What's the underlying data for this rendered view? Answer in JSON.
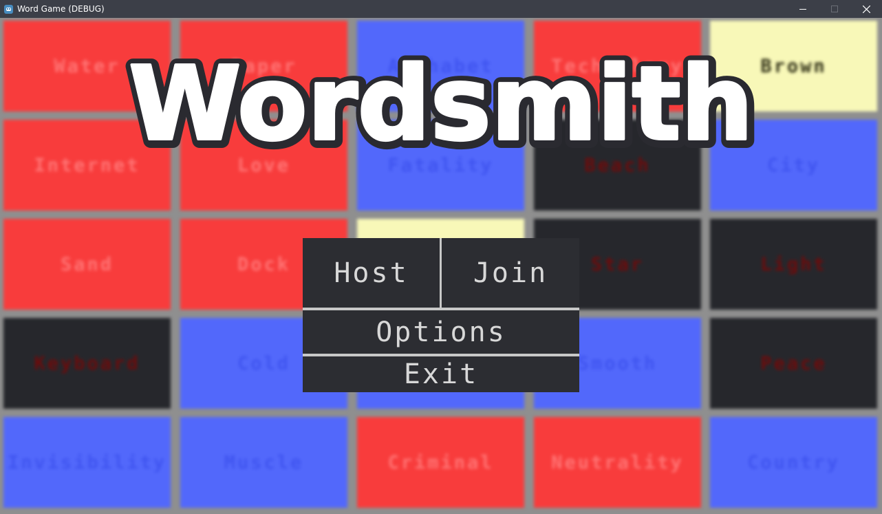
{
  "window": {
    "title": "Word Game (DEBUG)",
    "controls": [
      "minimize-icon",
      "maximize-icon",
      "close-icon"
    ]
  },
  "logo": {
    "text": "Wordsmith"
  },
  "menu": {
    "host": "Host",
    "join": "Join",
    "options": "Options",
    "exit": "Exit"
  },
  "board": {
    "cards": [
      {
        "word": "Water",
        "color": "red"
      },
      {
        "word": "Paper",
        "color": "red"
      },
      {
        "word": "Alphabet",
        "color": "blue"
      },
      {
        "word": "Technology",
        "color": "red"
      },
      {
        "word": "Brown",
        "color": "yellow"
      },
      {
        "word": "Internet",
        "color": "red"
      },
      {
        "word": "Love",
        "color": "red"
      },
      {
        "word": "Fatality",
        "color": "blue"
      },
      {
        "word": "Beach",
        "color": "black"
      },
      {
        "word": "City",
        "color": "blue"
      },
      {
        "word": "Sand",
        "color": "red"
      },
      {
        "word": "Dock",
        "color": "red"
      },
      {
        "word": "",
        "color": "yellow"
      },
      {
        "word": "Star",
        "color": "black"
      },
      {
        "word": "Light",
        "color": "black"
      },
      {
        "word": "Keyboard",
        "color": "black"
      },
      {
        "word": "Cold",
        "color": "blue"
      },
      {
        "word": "",
        "color": "blue"
      },
      {
        "word": "Smooth",
        "color": "blue"
      },
      {
        "word": "Peace",
        "color": "black"
      },
      {
        "word": "Invisibility",
        "color": "blue"
      },
      {
        "word": "Muscle",
        "color": "blue"
      },
      {
        "word": "Criminal",
        "color": "red"
      },
      {
        "word": "Neutrality",
        "color": "red"
      },
      {
        "word": "Country",
        "color": "blue"
      }
    ]
  },
  "colors": {
    "red": "#f83c3c",
    "blue": "#5268fb",
    "black": "#26272c",
    "yellow": "#f8f8b8",
    "menu_button": "#2c2d32",
    "menu_text": "#d8d8d8",
    "titlebar": "#3c3f48"
  }
}
